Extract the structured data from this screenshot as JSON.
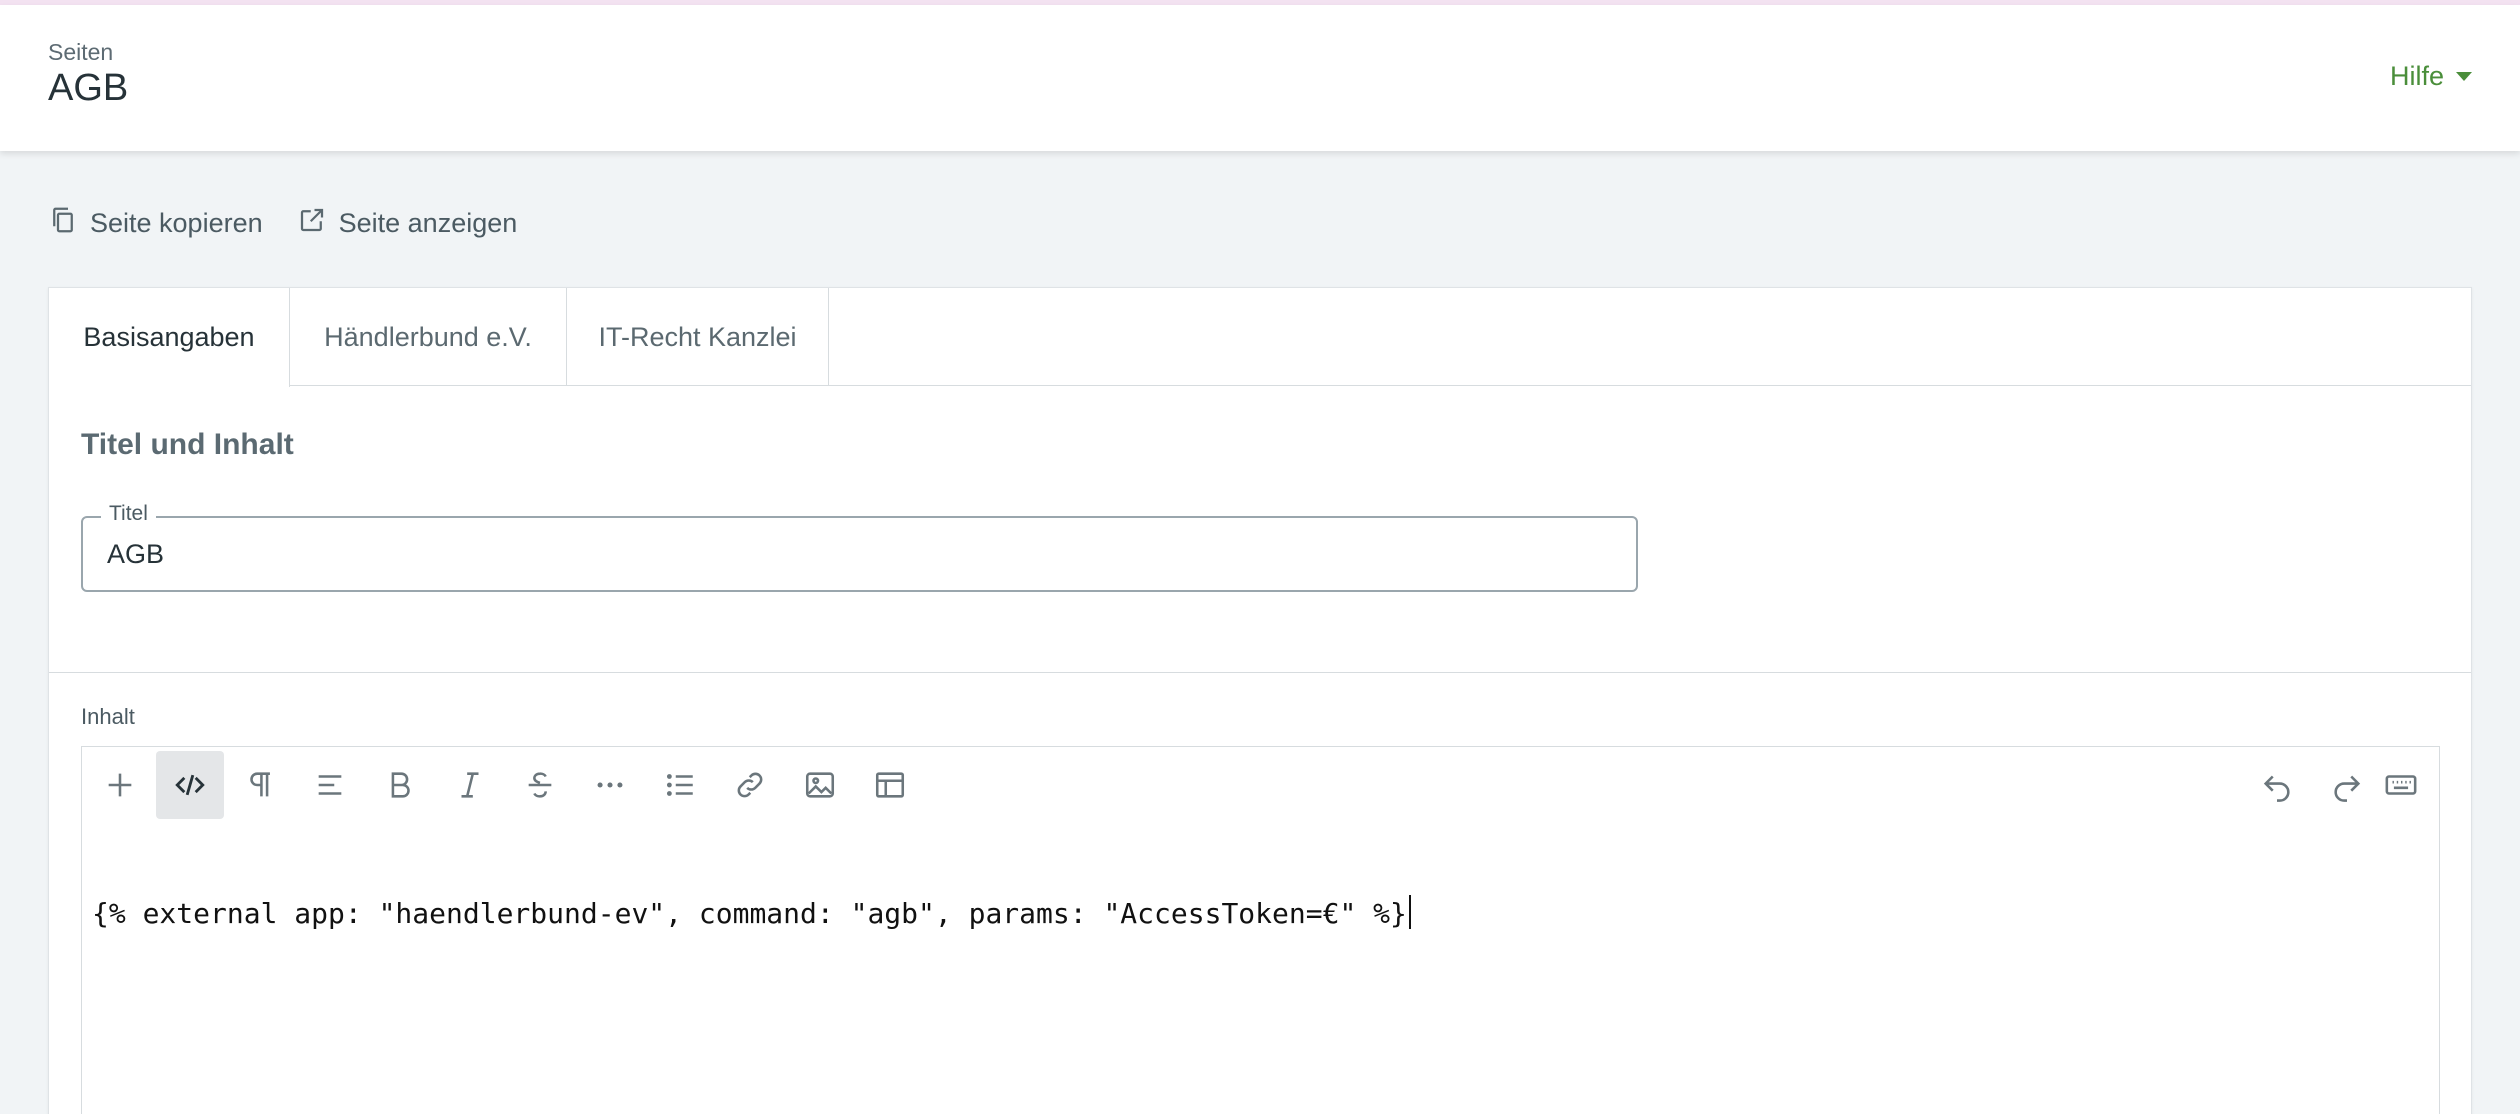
{
  "header": {
    "breadcrumb": "Seiten",
    "title": "AGB",
    "help_label": "Hilfe"
  },
  "actions": {
    "copy_label": "Seite kopieren",
    "view_label": "Seite anzeigen"
  },
  "tabs": [
    {
      "label": "Basisangaben",
      "active": true
    },
    {
      "label": "Händlerbund e.V.",
      "active": false
    },
    {
      "label": "IT-Recht Kanzlei",
      "active": false
    }
  ],
  "section": {
    "title": "Titel und Inhalt",
    "title_field_label": "Titel",
    "title_field_value": "AGB"
  },
  "content": {
    "label": "Inhalt",
    "code": "{% external app: \"haendlerbund-ev\", command: \"agb\", params: \"AccessToken=€\" %}"
  },
  "toolbar_icons": [
    "plus-icon",
    "code-icon",
    "paragraph-icon",
    "align-icon",
    "bold-icon",
    "italic-icon",
    "strikethrough-icon",
    "more-icon",
    "list-icon",
    "link-icon",
    "image-icon",
    "table-icon",
    "undo-icon",
    "redo-icon",
    "keyboard-icon"
  ],
  "colors": {
    "accent_green": "#4a8e3a",
    "page_background": "#f1f4f6"
  }
}
